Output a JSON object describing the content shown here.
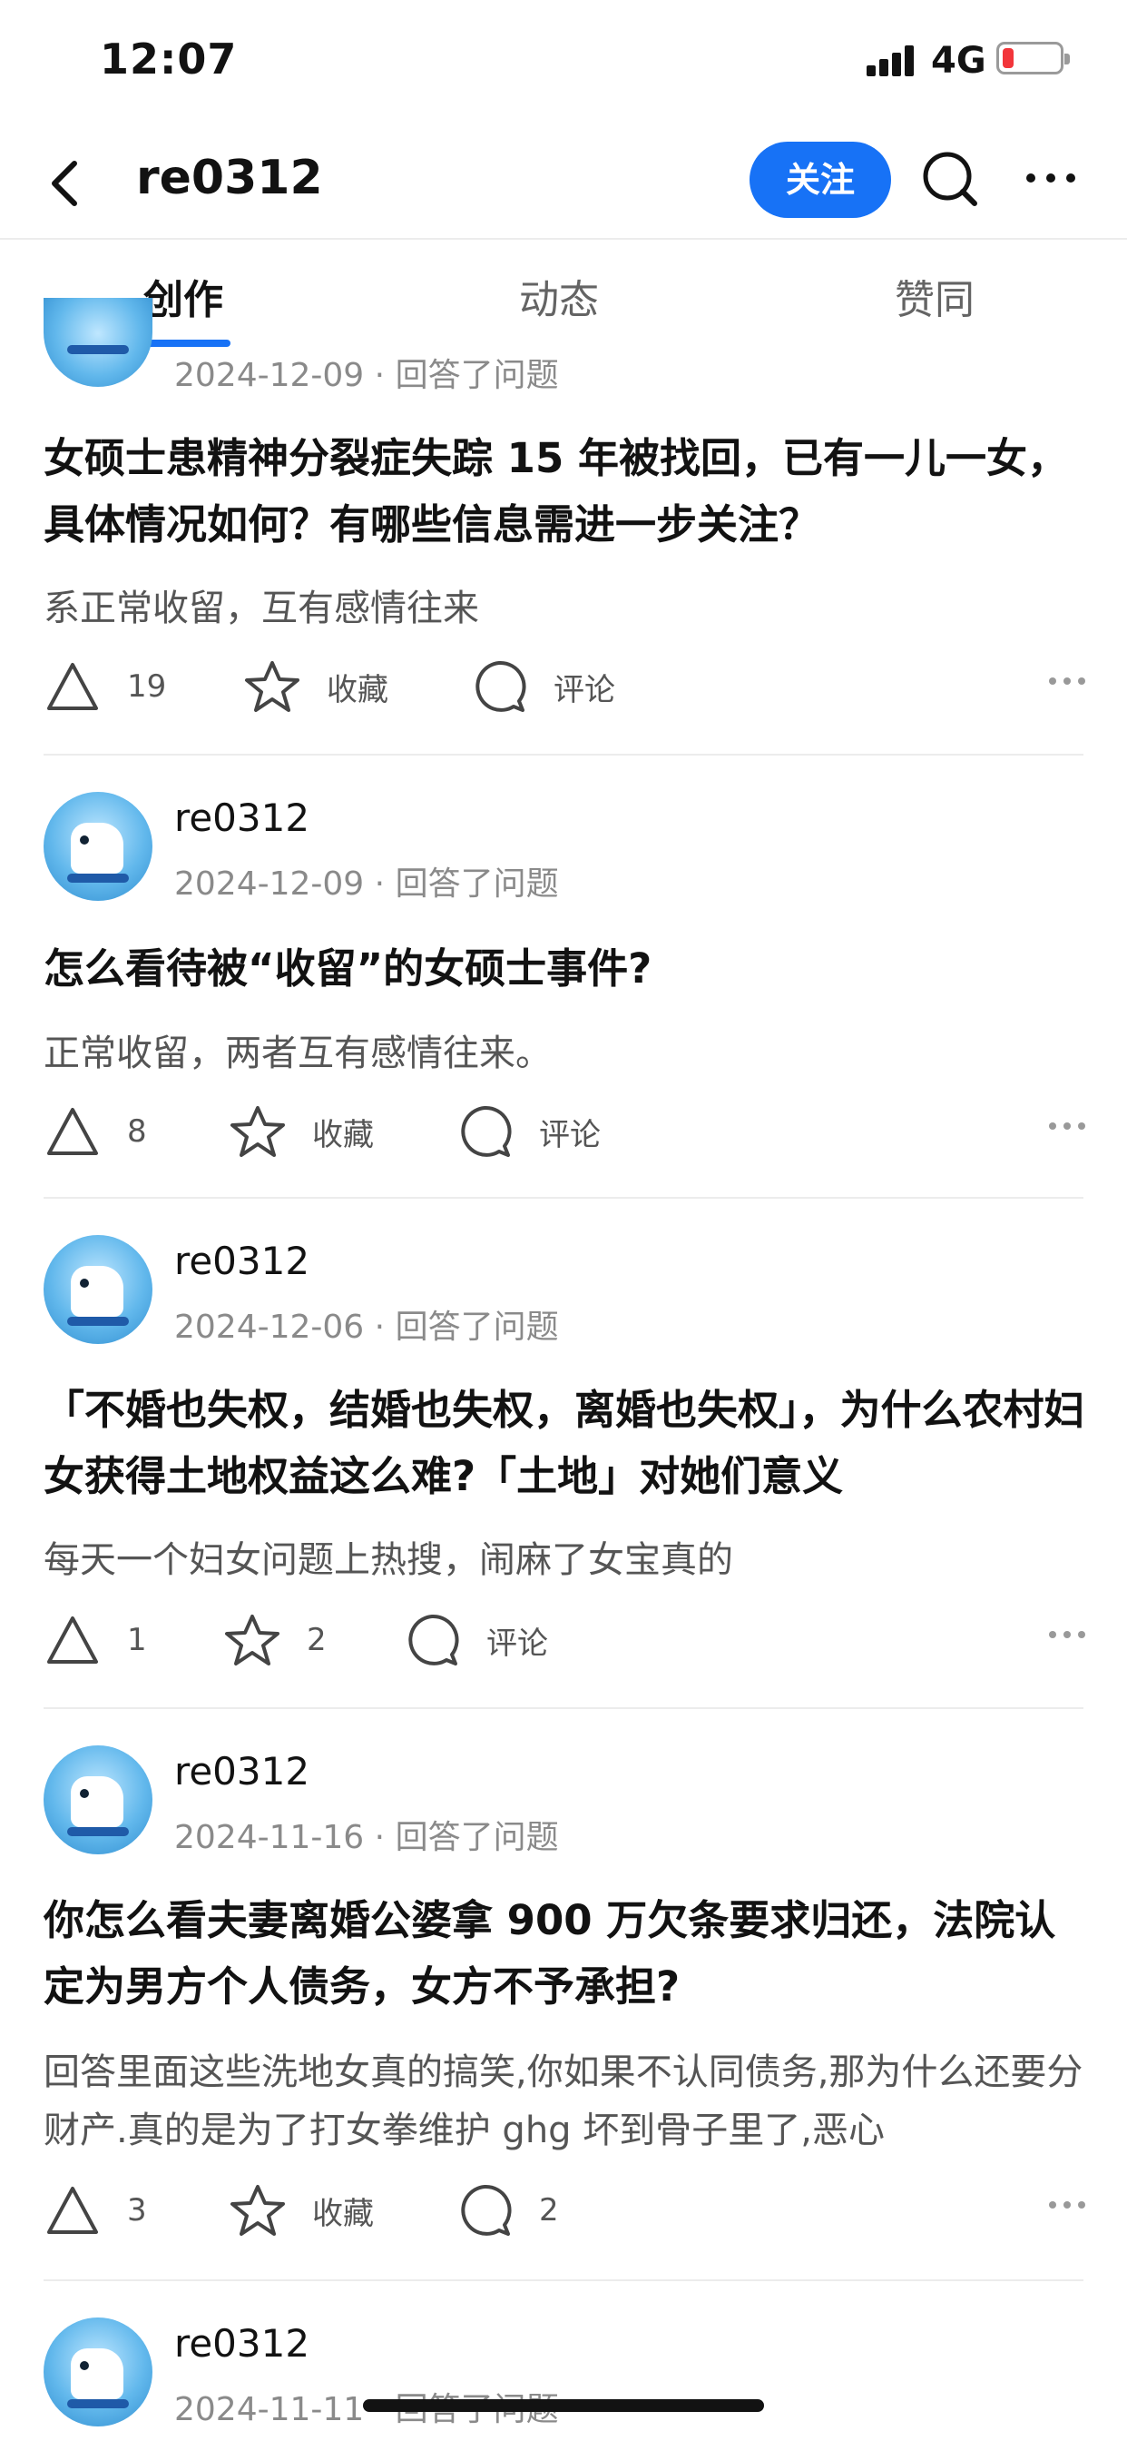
{
  "status_bar": {
    "time": "12:07",
    "network": "4G",
    "battery_color": "#f2353a"
  },
  "header": {
    "title": "re0312",
    "follow_label": "关注",
    "accent": "#1772f6"
  },
  "tabs": [
    {
      "label": "创作",
      "active": true
    },
    {
      "label": "动态",
      "active": false
    },
    {
      "label": "赞同",
      "active": false
    }
  ],
  "cards": [
    {
      "author": "",
      "date": "2024-12-09",
      "action": "回答了问题",
      "title": "女硕士患精神分裂症失踪 15 年被找回，已有一儿一女，具体情况如何？有哪些信息需进一步关注？",
      "excerpt": "系正常收留，互有感情往来",
      "upvote": "19",
      "favorite": "收藏",
      "comment": "评论"
    },
    {
      "author": "re0312",
      "date": "2024-12-09",
      "action": "回答了问题",
      "title": "怎么看待被“收留”的女硕士事件?",
      "excerpt": "正常收留，两者互有感情往来。",
      "upvote": "8",
      "favorite": "收藏",
      "comment": "评论"
    },
    {
      "author": "re0312",
      "date": "2024-12-06",
      "action": "回答了问题",
      "title": "「不婚也失权，结婚也失权，离婚也失权」，为什么农村妇女获得土地权益这么难?「土地」对她们意义",
      "excerpt": "每天一个妇女问题上热搜，闹麻了女宝真的",
      "upvote": "1",
      "favorite": "2",
      "comment": "评论"
    },
    {
      "author": "re0312",
      "date": "2024-11-16",
      "action": "回答了问题",
      "title": "你怎么看夫妻离婚公婆拿 900 万欠条要求归还，法院认定为男方个人债务，女方不予承担?",
      "excerpt": "回答里面这些洗地女真的搞笑,你如果不认同债务,那为什么还要分财产.真的是为了打女拳维护 ghg 坏到骨子里了,恶心",
      "upvote": "3",
      "favorite": "收藏",
      "comment": "2"
    },
    {
      "author": "re0312",
      "date": "2024-11-11",
      "action": "回答了问题"
    }
  ]
}
